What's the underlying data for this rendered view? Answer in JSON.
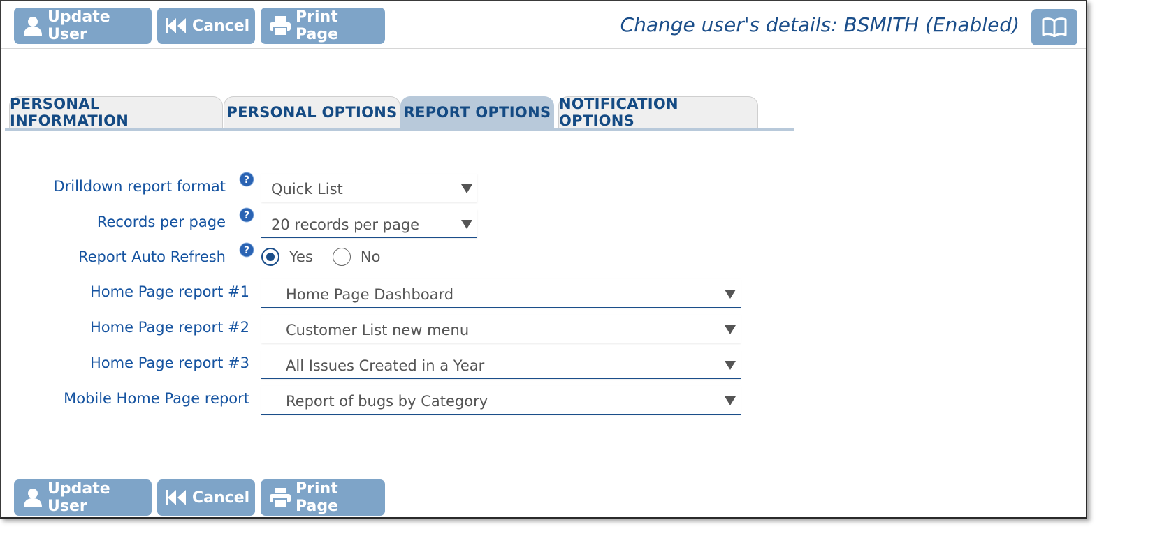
{
  "toolbar": {
    "update_label": "Update User",
    "cancel_label": "Cancel",
    "print_label": "Print Page"
  },
  "header": {
    "title": "Change user's details: BSMITH (Enabled)"
  },
  "tabs": [
    {
      "label": "PERSONAL INFORMATION",
      "active": false
    },
    {
      "label": "PERSONAL OPTIONS",
      "active": false
    },
    {
      "label": "REPORT OPTIONS",
      "active": true
    },
    {
      "label": "NOTIFICATION OPTIONS",
      "active": false
    }
  ],
  "form": {
    "drilldown": {
      "label": "Drilldown report format",
      "value": "Quick List"
    },
    "records": {
      "label": "Records per page",
      "value": "20 records per page"
    },
    "auto_refresh": {
      "label": "Report Auto Refresh",
      "yes": "Yes",
      "no": "No",
      "selected": "Yes"
    },
    "home1": {
      "label": "Home Page report #1",
      "value": "Home Page Dashboard"
    },
    "home2": {
      "label": "Home Page report #2",
      "value": "Customer List new menu"
    },
    "home3": {
      "label": "Home Page report #3",
      "value": "All Issues Created in a Year"
    },
    "mobile": {
      "label": "Mobile Home Page report",
      "value": "Report of bugs by Category"
    }
  },
  "colors": {
    "button": "#7ea4c8",
    "label_text": "#1553a0",
    "title_text": "#1b4e8a",
    "tab_active": "#b8c9da",
    "tab_inactive": "#efefef"
  },
  "icons": {
    "update": "user-icon",
    "cancel": "rewind-icon",
    "print": "printer-icon",
    "help": "book-icon",
    "field_help": "question-icon",
    "dropdown": "caret-down-icon"
  }
}
